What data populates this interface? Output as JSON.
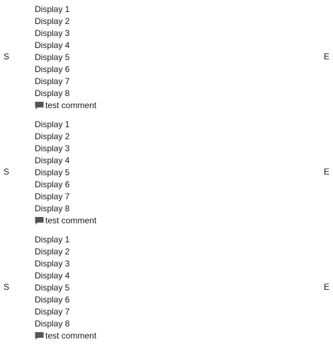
{
  "groups": [
    {
      "start_label": "S",
      "end_label": "E",
      "items": [
        "Display 1",
        "Display 2",
        "Display 3",
        "Display 4",
        "Display 5",
        "Display 6",
        "Display 7",
        "Display 8"
      ],
      "comment": {
        "icon": "comment-icon",
        "text": "test comment"
      }
    },
    {
      "start_label": "S",
      "end_label": "E",
      "items": [
        "Display 1",
        "Display 2",
        "Display 3",
        "Display 4",
        "Display 5",
        "Display 6",
        "Display 7",
        "Display 8"
      ],
      "comment": {
        "icon": "comment-icon",
        "text": "test comment"
      }
    },
    {
      "start_label": "S",
      "end_label": "E",
      "items": [
        "Display 1",
        "Display 2",
        "Display 3",
        "Display 4",
        "Display 5",
        "Display 6",
        "Display 7",
        "Display 8"
      ],
      "comment": {
        "icon": "comment-icon",
        "text": "test comment"
      }
    }
  ],
  "colors": {
    "text": "#1a1a1a",
    "icon": "#555555"
  }
}
